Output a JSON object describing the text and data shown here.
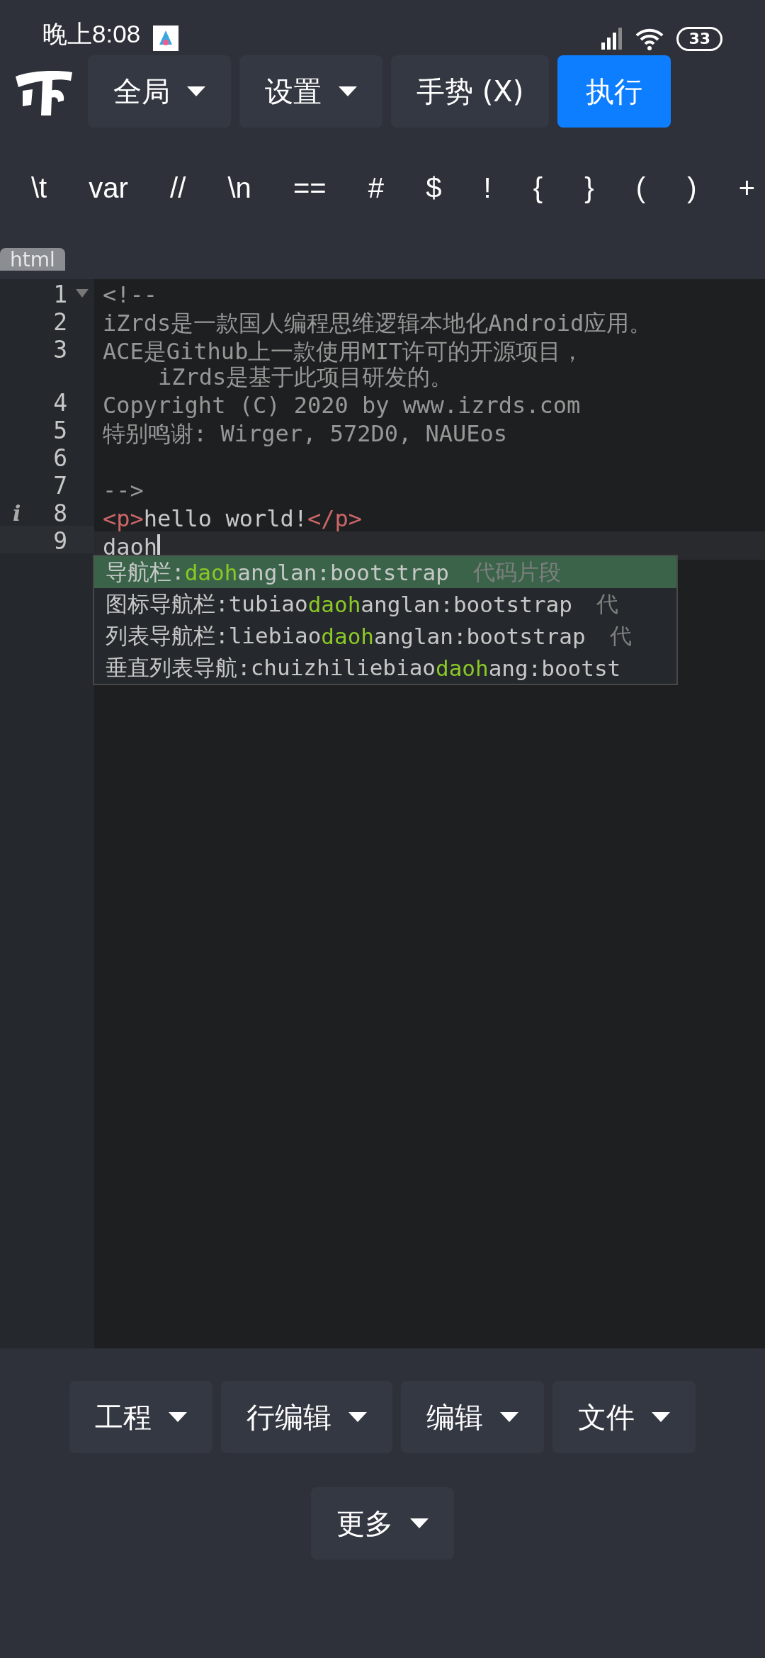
{
  "status_bar": {
    "time": "晚上8:08",
    "battery": "33"
  },
  "toolbar": {
    "buttons": [
      {
        "label": "全局",
        "kind": "dropdown"
      },
      {
        "label": "设置",
        "kind": "dropdown"
      },
      {
        "label": "手势 (X)",
        "kind": "plain"
      },
      {
        "label": "执行",
        "kind": "primary"
      }
    ]
  },
  "snippet_keys": [
    "\\t",
    "var",
    "//",
    "\\n",
    "==",
    "#",
    "$",
    "!",
    "{",
    "}",
    "(",
    ")",
    "+"
  ],
  "mode_badge": "html",
  "editor": {
    "lines": [
      {
        "number": "1",
        "fold": true,
        "active": false,
        "segments": [
          {
            "kind": "comment",
            "text": "<!--"
          }
        ]
      },
      {
        "number": "2",
        "fold": false,
        "active": false,
        "segments": [
          {
            "kind": "comment",
            "text": "iZrds是一款国人编程思维逻辑本地化Android应用。"
          }
        ]
      },
      {
        "number": "3",
        "fold": false,
        "active": false,
        "segments": [
          {
            "kind": "comment",
            "text": "ACE是Github上一款使用MIT许可的开源项目，"
          }
        ],
        "continuation": "iZrds是基于此项目研发的。"
      },
      {
        "number": "4",
        "fold": false,
        "active": false,
        "segments": [
          {
            "kind": "comment",
            "text": "Copyright (C) 2020 by www.izrds.com"
          }
        ]
      },
      {
        "number": "5",
        "fold": false,
        "active": false,
        "segments": [
          {
            "kind": "comment",
            "text": "特别鸣谢: Wirger, 572D0, NAUEos"
          }
        ]
      },
      {
        "number": "6",
        "fold": false,
        "active": false
      },
      {
        "number": "7",
        "fold": false,
        "active": false,
        "segments": [
          {
            "kind": "comment",
            "text": "-->"
          }
        ]
      },
      {
        "number": "8",
        "fold": false,
        "marker": "i",
        "active": false,
        "segments": [
          {
            "kind": "tag",
            "text": "<p>"
          },
          {
            "kind": "text",
            "text": "hello world!"
          },
          {
            "kind": "tag",
            "text": "</p>"
          }
        ]
      },
      {
        "number": "9",
        "fold": false,
        "active": true,
        "segments": [
          {
            "kind": "text",
            "text": "daoh"
          }
        ]
      }
    ]
  },
  "autocomplete": [
    {
      "prefix": "导航栏:",
      "match": "daoh",
      "suffix": "anglan:bootstrap",
      "meta": "代码片段",
      "selected": true
    },
    {
      "prefix": "图标导航栏:tubiao",
      "match": "daoh",
      "suffix": "anglan:bootstrap",
      "meta": "代",
      "selected": false
    },
    {
      "prefix": "列表导航栏:liebiao",
      "match": "daoh",
      "suffix": "anglan:bootstrap",
      "meta": "代",
      "selected": false
    },
    {
      "prefix": "垂直列表导航:chuizhiliebiao",
      "match": "daoh",
      "suffix": "ang:bootst",
      "selected": false
    }
  ],
  "bottom_menu": [
    {
      "label": "工程",
      "kind": "dropdown"
    },
    {
      "label": "行编辑",
      "kind": "dropdown"
    },
    {
      "label": "编辑",
      "kind": "dropdown"
    },
    {
      "label": "文件",
      "kind": "dropdown"
    },
    {
      "label": "更多",
      "kind": "dropdown"
    }
  ]
}
